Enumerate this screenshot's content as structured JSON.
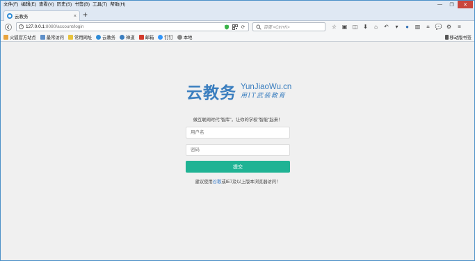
{
  "menu": [
    "文件(F)",
    "编辑(E)",
    "查看(V)",
    "历史(S)",
    "书签(B)",
    "工具(T)",
    "帮助(H)"
  ],
  "window_controls": {
    "minimize": "—",
    "restore": "❐",
    "close": "✕"
  },
  "tab": {
    "title": "云教务",
    "close": "×",
    "new_tab": "+"
  },
  "address": {
    "host": "127.0.0.1",
    "path": ":8080/account/login"
  },
  "search": {
    "placeholder": "百度 <Ctrl+K>"
  },
  "bookmarks": [
    {
      "label": "火狐官方站点",
      "color": "#e8a33d"
    },
    {
      "label": "最常访问",
      "color": "#5d8fc9"
    },
    {
      "label": "常用网址",
      "color": "#e8c33d"
    },
    {
      "label": "云教务",
      "color": "#2e8bd6"
    },
    {
      "label": "禅道",
      "color": "#3a7ebf"
    },
    {
      "label": "邮箱",
      "color": "#d33a2c"
    },
    {
      "label": "钉钉",
      "color": "#3296fa"
    },
    {
      "label": "本地",
      "color": "#888888"
    }
  ],
  "bookmarks_right": "移动版书签",
  "logo": {
    "main": "云教务",
    "en": "YunJiaoWu.cn",
    "slogan": "用IT武装教育"
  },
  "tagline": "做互联网时代\"智库\"，让你的学校\"智能\"起来！",
  "form": {
    "username_placeholder": "用户名",
    "password_placeholder": "密码",
    "submit_label": "提交"
  },
  "hint": {
    "before": "建议使用",
    "link": "谷歌",
    "after": "或IE7及以上版本浏览器访问！"
  },
  "colors": {
    "brand": "#3a7ebf",
    "submit": "#1fb394",
    "link": "#2a73c5"
  }
}
